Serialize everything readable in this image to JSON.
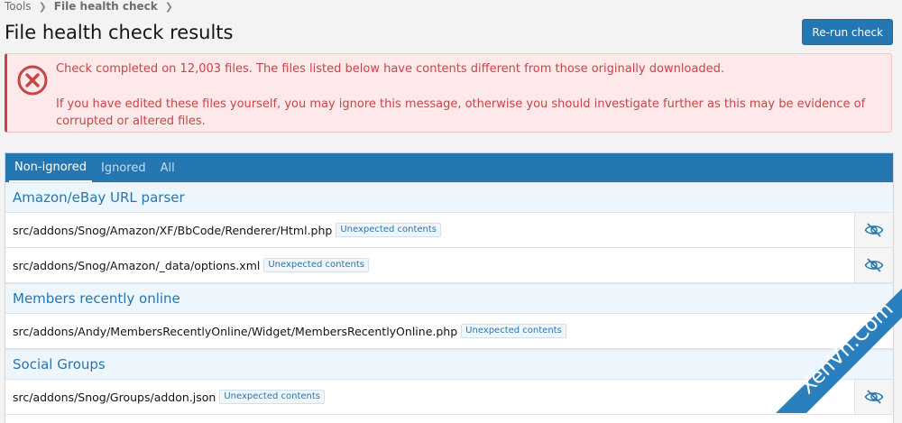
{
  "breadcrumb": {
    "items": [
      "Tools",
      "File health check"
    ]
  },
  "page_title": "File health check results",
  "rerun_button": "Re-run check",
  "alert": {
    "line1": "Check completed on 12,003 files. The files listed below have contents different from those originally downloaded.",
    "line2": "If you have edited these files yourself, you may ignore this message, otherwise you should investigate further as this may be evidence of corrupted or altered files."
  },
  "tabs": [
    {
      "label": "Non-ignored",
      "active": true
    },
    {
      "label": "Ignored",
      "active": false
    },
    {
      "label": "All",
      "active": false
    }
  ],
  "groups": [
    {
      "title": "Amazon/eBay URL parser",
      "files": [
        {
          "path": "src/addons/Snog/Amazon/XF/BbCode/Renderer/Html.php",
          "badge": "Unexpected contents"
        },
        {
          "path": "src/addons/Snog/Amazon/_data/options.xml",
          "badge": "Unexpected contents"
        }
      ]
    },
    {
      "title": "Members recently online",
      "files": [
        {
          "path": "src/addons/Andy/MembersRecentlyOnline/Widget/MembersRecentlyOnline.php",
          "badge": "Unexpected contents"
        }
      ]
    },
    {
      "title": "Social Groups",
      "files": [
        {
          "path": "src/addons/Snog/Groups/addon.json",
          "badge": "Unexpected contents"
        }
      ]
    }
  ],
  "watermark": "XenVn.Com",
  "colors": {
    "accent": "#2577b1",
    "error": "#c84448",
    "error_bg": "#fde9e9",
    "group_bg": "#edf6fd"
  },
  "icons": {
    "alert": "error-x-circle-icon",
    "row_action": "eye-slash-icon"
  }
}
